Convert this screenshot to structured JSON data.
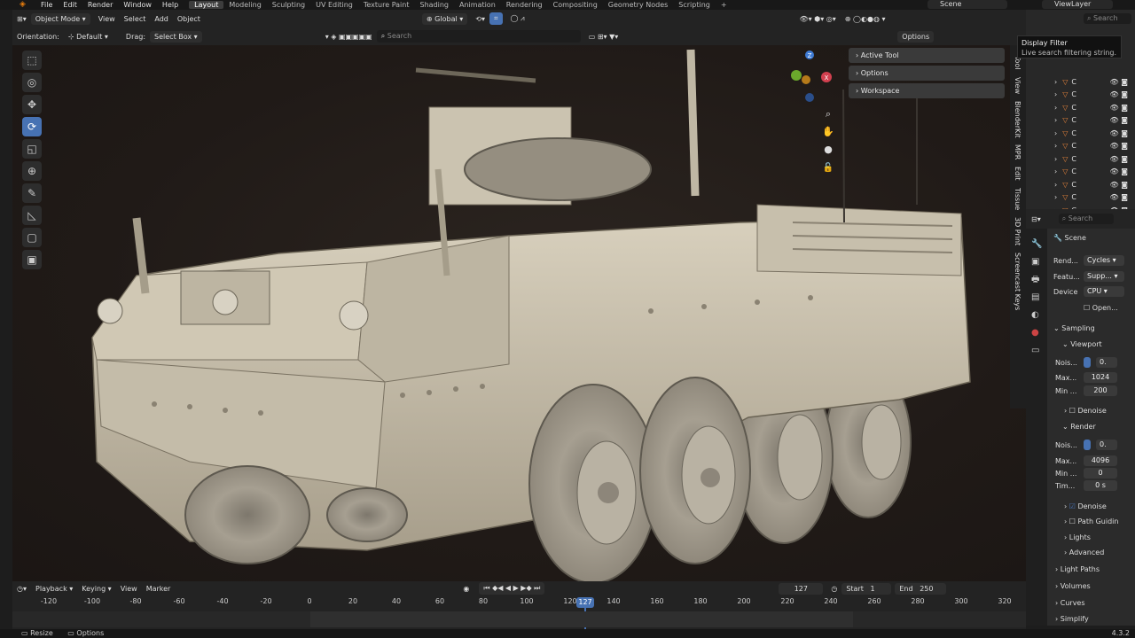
{
  "top_menu": [
    "File",
    "Edit",
    "Render",
    "Window",
    "Help"
  ],
  "workspaces": [
    {
      "label": "Layout",
      "active": true
    },
    {
      "label": "Modeling"
    },
    {
      "label": "Sculpting"
    },
    {
      "label": "UV Editing"
    },
    {
      "label": "Texture Paint"
    },
    {
      "label": "Shading"
    },
    {
      "label": "Animation"
    },
    {
      "label": "Rendering"
    },
    {
      "label": "Compositing"
    },
    {
      "label": "Geometry Nodes"
    },
    {
      "label": "Scripting"
    }
  ],
  "scene_name": "Scene",
  "view_layer": "ViewLayer",
  "header1": {
    "mode": "Object Mode",
    "menus": [
      "View",
      "Select",
      "Add",
      "Object"
    ],
    "transform": "Global"
  },
  "header2": {
    "orientation_label": "Orientation:",
    "orientation": "Default",
    "drag_label": "Drag:",
    "drag": "Select Box",
    "search_placeholder": "Search",
    "options": "Options"
  },
  "npanel": [
    "Active Tool",
    "Options",
    "Workspace"
  ],
  "side_tabs": [
    "Tool",
    "View",
    "BlenderKit",
    "MPR",
    "Edit",
    "Tissue",
    "3D Print",
    "Screencast Keys"
  ],
  "tooltip": {
    "title": "Display Filter",
    "body": "Live search filtering string."
  },
  "outliner": {
    "search_placeholder": "Search",
    "rows": [
      "C",
      "C",
      "C",
      "C",
      "C",
      "C",
      "C",
      "C",
      "C",
      "C",
      "C"
    ]
  },
  "properties": {
    "search_placeholder": "Search",
    "scene": "Scene",
    "render_engine_label": "Rend...",
    "render_engine": "Cycles",
    "feature_label": "Featu...",
    "feature": "Supp...",
    "device_label": "Device",
    "device": "CPU",
    "open": "Open...",
    "sampling": "Sampling",
    "viewport": "Viewport",
    "v_noise_label": "Nois...",
    "v_noise": "0.",
    "v_max_label": "Max...",
    "v_max": "1024",
    "v_min_label": "Min ...",
    "v_min": "200",
    "denoise": "Denoise",
    "render": "Render",
    "r_noise_label": "Nois...",
    "r_noise": "0.",
    "r_max_label": "Max...",
    "r_max": "4096",
    "r_min_label": "Min ...",
    "r_min": "0",
    "r_time_label": "Tim...",
    "r_time": "0 s",
    "denoise2": "Denoise",
    "path_guiding": "Path Guidin",
    "lights": "Lights",
    "advanced": "Advanced",
    "light_paths": "Light Paths",
    "volumes": "Volumes",
    "curves": "Curves",
    "simplify": "Simplify"
  },
  "timeline": {
    "menus": [
      "Playback",
      "Keying",
      "View",
      "Marker"
    ],
    "frame": "127",
    "start_label": "Start",
    "start": "1",
    "end_label": "End",
    "end": "250",
    "current": "127",
    "ticks": [
      "-120",
      "-100",
      "-80",
      "-60",
      "-40",
      "-20",
      "0",
      "20",
      "40",
      "60",
      "80",
      "100",
      "120",
      "140",
      "160",
      "180",
      "200",
      "220",
      "240",
      "260",
      "280",
      "300",
      "320"
    ]
  },
  "status": {
    "resize": "Resize",
    "options": "Options",
    "version": "4.3.2"
  },
  "colors": {
    "accent": "#4772b3",
    "orange": "#e8843b",
    "vehicle": "#c9c0ad"
  }
}
